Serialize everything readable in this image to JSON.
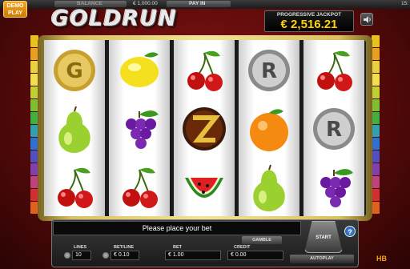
{
  "top_bar": {
    "demo_line1": "DEMO",
    "demo_line2": "PLAY",
    "balance_label": "BALANCE",
    "balance_value": "€ 1,000.00",
    "pay_in_label": "PAY IN",
    "clock": "15:"
  },
  "logo_text": "GOLDRUN",
  "jackpot": {
    "label": "PROGRESSIVE JACKPOT",
    "value": "€ 2,516.21"
  },
  "reels": [
    [
      "gold-coin",
      "pear",
      "cherry"
    ],
    [
      "lemon",
      "grapes",
      "cherry"
    ],
    [
      "cherry",
      "gold-emblem",
      "watermelon"
    ],
    [
      "silver-coin",
      "orange",
      "pear"
    ],
    [
      "cherry",
      "silver-coin",
      "grapes"
    ]
  ],
  "console": {
    "message": "Please place your bet",
    "gamble_label": "GAMBLE",
    "start_label": "START",
    "autoplay_label": "AUTOPLAY",
    "help_label": "?",
    "lines_label": "LINES",
    "lines_value": "10",
    "bet_line_label": "BET/LINE",
    "bet_line_value": "€ 0.10",
    "bet_label": "BET",
    "bet_value": "€ 1.00",
    "credit_label": "CREDIT",
    "credit_value": "€ 0.00"
  },
  "brand_text": "HB"
}
